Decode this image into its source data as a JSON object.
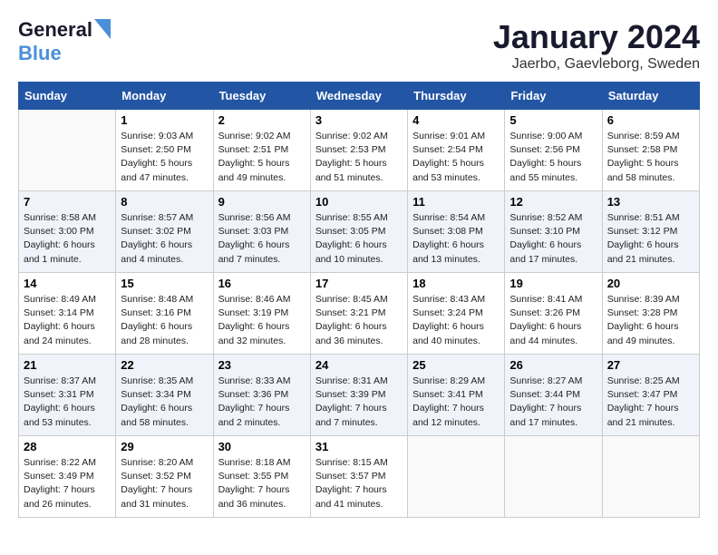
{
  "header": {
    "logo_general": "General",
    "logo_blue": "Blue",
    "month_title": "January 2024",
    "location": "Jaerbo, Gaevleborg, Sweden"
  },
  "calendar": {
    "days_of_week": [
      "Sunday",
      "Monday",
      "Tuesday",
      "Wednesday",
      "Thursday",
      "Friday",
      "Saturday"
    ],
    "weeks": [
      [
        {
          "day": "",
          "info": ""
        },
        {
          "day": "1",
          "info": "Sunrise: 9:03 AM\nSunset: 2:50 PM\nDaylight: 5 hours\nand 47 minutes."
        },
        {
          "day": "2",
          "info": "Sunrise: 9:02 AM\nSunset: 2:51 PM\nDaylight: 5 hours\nand 49 minutes."
        },
        {
          "day": "3",
          "info": "Sunrise: 9:02 AM\nSunset: 2:53 PM\nDaylight: 5 hours\nand 51 minutes."
        },
        {
          "day": "4",
          "info": "Sunrise: 9:01 AM\nSunset: 2:54 PM\nDaylight: 5 hours\nand 53 minutes."
        },
        {
          "day": "5",
          "info": "Sunrise: 9:00 AM\nSunset: 2:56 PM\nDaylight: 5 hours\nand 55 minutes."
        },
        {
          "day": "6",
          "info": "Sunrise: 8:59 AM\nSunset: 2:58 PM\nDaylight: 5 hours\nand 58 minutes."
        }
      ],
      [
        {
          "day": "7",
          "info": "Sunrise: 8:58 AM\nSunset: 3:00 PM\nDaylight: 6 hours\nand 1 minute."
        },
        {
          "day": "8",
          "info": "Sunrise: 8:57 AM\nSunset: 3:02 PM\nDaylight: 6 hours\nand 4 minutes."
        },
        {
          "day": "9",
          "info": "Sunrise: 8:56 AM\nSunset: 3:03 PM\nDaylight: 6 hours\nand 7 minutes."
        },
        {
          "day": "10",
          "info": "Sunrise: 8:55 AM\nSunset: 3:05 PM\nDaylight: 6 hours\nand 10 minutes."
        },
        {
          "day": "11",
          "info": "Sunrise: 8:54 AM\nSunset: 3:08 PM\nDaylight: 6 hours\nand 13 minutes."
        },
        {
          "day": "12",
          "info": "Sunrise: 8:52 AM\nSunset: 3:10 PM\nDaylight: 6 hours\nand 17 minutes."
        },
        {
          "day": "13",
          "info": "Sunrise: 8:51 AM\nSunset: 3:12 PM\nDaylight: 6 hours\nand 21 minutes."
        }
      ],
      [
        {
          "day": "14",
          "info": "Sunrise: 8:49 AM\nSunset: 3:14 PM\nDaylight: 6 hours\nand 24 minutes."
        },
        {
          "day": "15",
          "info": "Sunrise: 8:48 AM\nSunset: 3:16 PM\nDaylight: 6 hours\nand 28 minutes."
        },
        {
          "day": "16",
          "info": "Sunrise: 8:46 AM\nSunset: 3:19 PM\nDaylight: 6 hours\nand 32 minutes."
        },
        {
          "day": "17",
          "info": "Sunrise: 8:45 AM\nSunset: 3:21 PM\nDaylight: 6 hours\nand 36 minutes."
        },
        {
          "day": "18",
          "info": "Sunrise: 8:43 AM\nSunset: 3:24 PM\nDaylight: 6 hours\nand 40 minutes."
        },
        {
          "day": "19",
          "info": "Sunrise: 8:41 AM\nSunset: 3:26 PM\nDaylight: 6 hours\nand 44 minutes."
        },
        {
          "day": "20",
          "info": "Sunrise: 8:39 AM\nSunset: 3:28 PM\nDaylight: 6 hours\nand 49 minutes."
        }
      ],
      [
        {
          "day": "21",
          "info": "Sunrise: 8:37 AM\nSunset: 3:31 PM\nDaylight: 6 hours\nand 53 minutes."
        },
        {
          "day": "22",
          "info": "Sunrise: 8:35 AM\nSunset: 3:34 PM\nDaylight: 6 hours\nand 58 minutes."
        },
        {
          "day": "23",
          "info": "Sunrise: 8:33 AM\nSunset: 3:36 PM\nDaylight: 7 hours\nand 2 minutes."
        },
        {
          "day": "24",
          "info": "Sunrise: 8:31 AM\nSunset: 3:39 PM\nDaylight: 7 hours\nand 7 minutes."
        },
        {
          "day": "25",
          "info": "Sunrise: 8:29 AM\nSunset: 3:41 PM\nDaylight: 7 hours\nand 12 minutes."
        },
        {
          "day": "26",
          "info": "Sunrise: 8:27 AM\nSunset: 3:44 PM\nDaylight: 7 hours\nand 17 minutes."
        },
        {
          "day": "27",
          "info": "Sunrise: 8:25 AM\nSunset: 3:47 PM\nDaylight: 7 hours\nand 21 minutes."
        }
      ],
      [
        {
          "day": "28",
          "info": "Sunrise: 8:22 AM\nSunset: 3:49 PM\nDaylight: 7 hours\nand 26 minutes."
        },
        {
          "day": "29",
          "info": "Sunrise: 8:20 AM\nSunset: 3:52 PM\nDaylight: 7 hours\nand 31 minutes."
        },
        {
          "day": "30",
          "info": "Sunrise: 8:18 AM\nSunset: 3:55 PM\nDaylight: 7 hours\nand 36 minutes."
        },
        {
          "day": "31",
          "info": "Sunrise: 8:15 AM\nSunset: 3:57 PM\nDaylight: 7 hours\nand 41 minutes."
        },
        {
          "day": "",
          "info": ""
        },
        {
          "day": "",
          "info": ""
        },
        {
          "day": "",
          "info": ""
        }
      ]
    ]
  }
}
